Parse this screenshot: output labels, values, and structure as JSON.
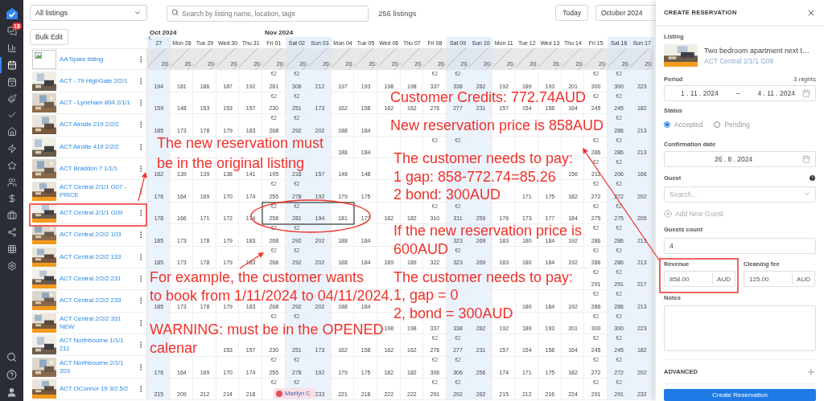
{
  "sidebar": {
    "items": [
      {
        "selected": false,
        "badge": "18"
      },
      {
        "selected": false
      },
      {
        "selected": true
      },
      {
        "selected": false
      },
      {
        "selected": false
      },
      {
        "selected": false
      },
      {
        "selected": false
      },
      {
        "selected": false
      },
      {
        "selected": false
      },
      {
        "selected": false
      },
      {
        "selected": false
      },
      {
        "selected": false
      },
      {
        "selected": false
      },
      {
        "selected": false
      },
      {
        "selected": false
      }
    ],
    "bottom_items": [
      {
        "selected": false
      },
      {
        "selected": false
      },
      {
        "selected": false
      }
    ]
  },
  "toolbar": {
    "filter": "All listings",
    "search_placeholder": "Search by listing name, location, tags",
    "count": "256 listings",
    "today": "Today",
    "month": "October 2024",
    "bulk_edit": "Bulk Edit"
  },
  "days": [
    {
      "label": "27",
      "weekend": true,
      "month": "Oct 2024"
    },
    {
      "label": "Mon 28",
      "weekend": false
    },
    {
      "label": "Tue 29",
      "weekend": false
    },
    {
      "label": "Wed 30",
      "weekend": false
    },
    {
      "label": "Thu 31",
      "weekend": false
    },
    {
      "label": "Fri 01",
      "weekend": false,
      "month": "Nov 2024"
    },
    {
      "label": "Sat 02",
      "weekend": true
    },
    {
      "label": "Sun 03",
      "weekend": true
    },
    {
      "label": "Mon 04",
      "weekend": false
    },
    {
      "label": "Tue 05",
      "weekend": false
    },
    {
      "label": "Wed 06",
      "weekend": false
    },
    {
      "label": "Thu 07",
      "weekend": false
    },
    {
      "label": "Fri 08",
      "weekend": false
    },
    {
      "label": "Sat 09",
      "weekend": true
    },
    {
      "label": "Sun 10",
      "weekend": true
    },
    {
      "label": "Mon 11",
      "weekend": false
    },
    {
      "label": "Tue 12",
      "weekend": false
    },
    {
      "label": "Wed 13",
      "weekend": false
    },
    {
      "label": "Thu 14",
      "weekend": false
    },
    {
      "label": "Fri 15",
      "weekend": false
    },
    {
      "label": "Sat 16",
      "weekend": true
    },
    {
      "label": "Sun 17",
      "weekend": true
    }
  ],
  "rows": [
    {
      "name": "AA Spare listing",
      "image_missing": true,
      "tagged": false,
      "kind": "blocked",
      "cells": [
        {
          "price": "20"
        },
        {
          "price": "20"
        },
        {
          "price": "20"
        },
        {
          "price": "20"
        },
        {
          "price": "20"
        },
        {
          "price": "20"
        },
        {
          "price": "20"
        },
        {
          "price": "20"
        },
        {
          "price": "20"
        },
        {
          "price": "20"
        },
        {
          "price": "20"
        },
        {
          "price": "20"
        },
        {
          "price": "20"
        },
        {
          "price": "20"
        },
        {
          "price": "20"
        },
        {
          "price": "20"
        },
        {
          "price": "20"
        },
        {
          "price": "20"
        },
        {
          "price": "20"
        },
        {
          "price": "20"
        },
        {
          "price": "20"
        },
        {
          "price": "20"
        }
      ]
    },
    {
      "name": "ACT - 79 HighGate 2/2/1",
      "image_missing": false,
      "tagged": false,
      "kind": "priced",
      "cells": [
        {
          "price": "194"
        },
        {
          "price": "181"
        },
        {
          "price": "186"
        },
        {
          "price": "187"
        },
        {
          "price": "192"
        },
        {
          "badge": "€2",
          "price": "281"
        },
        {
          "badge": "€2",
          "price": "306"
        },
        {
          "price": "212"
        },
        {
          "price": "197"
        },
        {
          "price": "193"
        },
        {
          "price": "198"
        },
        {
          "price": "198"
        },
        {
          "badge": "€2",
          "price": "337"
        },
        {
          "badge": "€2",
          "price": "338"
        },
        {
          "price": "282"
        },
        {
          "price": "192"
        },
        {
          "price": "189"
        },
        {
          "price": "193"
        },
        {
          "price": "201"
        },
        {
          "badge": "€2",
          "price": "300"
        },
        {
          "badge": "€2",
          "price": "300"
        },
        {
          "price": "223"
        }
      ]
    },
    {
      "name": "ACT - Lyneham 804 2/1/1",
      "image_missing": false,
      "tagged": false,
      "kind": "priced",
      "cells": [
        {
          "price": "159"
        },
        {
          "price": "148"
        },
        {
          "price": "153"
        },
        {
          "price": "153"
        },
        {
          "price": "157"
        },
        {
          "badge": "€2",
          "price": "230"
        },
        {
          "badge": "€2",
          "price": "251"
        },
        {
          "price": "173"
        },
        {
          "price": "162"
        },
        {
          "price": "158"
        },
        {
          "price": "162"
        },
        {
          "price": "162"
        },
        {
          "price": "276"
        },
        {
          "price": "277"
        },
        {
          "price": "231"
        },
        {
          "price": "157"
        },
        {
          "price": "154"
        },
        {
          "price": "158"
        },
        {
          "price": "164"
        },
        {
          "badge": "€2",
          "price": "245"
        },
        {
          "badge": "€2",
          "price": "245"
        },
        {
          "price": "182"
        }
      ]
    },
    {
      "name": "ACT Ainslie 219 2/2/2",
      "image_missing": false,
      "tagged": false,
      "kind": "priced",
      "cells": [
        {
          "price": "185"
        },
        {
          "price": "173"
        },
        {
          "price": "178"
        },
        {
          "price": "179"
        },
        {
          "price": "183"
        },
        {
          "badge": "€2",
          "price": "268"
        },
        {
          "badge": "€2",
          "price": "292"
        },
        {
          "price": "202"
        },
        {
          "price": "188"
        },
        {
          "price": "184"
        },
        {},
        {},
        {},
        {},
        {},
        {},
        {},
        {},
        {},
        {},
        {
          "badge": "€2",
          "price": "286"
        },
        {
          "price": "213"
        }
      ]
    },
    {
      "name": "ACT Ainslie 419 2/2/2",
      "image_missing": false,
      "tagged": false,
      "kind": "priced",
      "cells": [
        {},
        {},
        {},
        {},
        {},
        {},
        {},
        {},
        {
          "price": "188"
        },
        {
          "price": "184"
        },
        {},
        {},
        {
          "badge": "€2"
        },
        {
          "badge": "€2"
        },
        {},
        {},
        {},
        {},
        {},
        {
          "badge": "€2",
          "price": "286"
        },
        {
          "badge": "€2",
          "price": "286"
        },
        {
          "price": "213"
        }
      ]
    },
    {
      "name": "ACT Braddon 7 1/1/1",
      "image_missing": false,
      "tagged": false,
      "kind": "priced",
      "cells": [
        {
          "price": "162"
        },
        {
          "price": "139"
        },
        {
          "price": "139"
        },
        {
          "price": "138"
        },
        {
          "price": "141"
        },
        {
          "price": "195"
        },
        {
          "price": "218"
        },
        {
          "price": "157"
        },
        {
          "price": "148"
        },
        {
          "price": "148"
        },
        {},
        {},
        {},
        {},
        {},
        {},
        {},
        {},
        {
          "price": "156"
        },
        {
          "badge": "€2",
          "price": "211"
        },
        {
          "badge": "€2",
          "price": "206"
        },
        {
          "price": "166"
        }
      ]
    },
    {
      "name": "ACT Central 2/1/1 G07 - PRICE",
      "image_missing": false,
      "tagged": true,
      "kind": "priced",
      "cells": [
        {
          "price": "176"
        },
        {
          "price": "164"
        },
        {
          "price": "169"
        },
        {
          "price": "170"
        },
        {
          "price": "174"
        },
        {
          "badge": "€2",
          "price": "255"
        },
        {
          "badge": "€2",
          "price": "278"
        },
        {
          "price": "192"
        },
        {
          "price": "179"
        },
        {
          "price": "175"
        },
        {},
        {},
        {},
        {},
        {},
        {},
        {
          "price": "171"
        },
        {
          "price": "175"
        },
        {
          "price": "182"
        },
        {
          "badge": "€2",
          "price": "272"
        },
        {
          "badge": "€2",
          "price": "272"
        },
        {
          "price": "202"
        }
      ]
    },
    {
      "name": "ACT Central 2/1/1 G09",
      "image_missing": false,
      "tagged": true,
      "kind": "priced",
      "cells": [
        {
          "price": "178"
        },
        {
          "price": "166"
        },
        {
          "price": "171"
        },
        {
          "price": "172"
        },
        {
          "price": "174"
        },
        {
          "badge": "€2",
          "price": "258"
        },
        {
          "badge": "€2",
          "price": "281"
        },
        {
          "price": "194"
        },
        {
          "price": "181"
        },
        {
          "price": "177"
        },
        {
          "price": "182"
        },
        {
          "price": "182"
        },
        {
          "badge": "€2",
          "price": "310"
        },
        {
          "badge": "€2",
          "price": "311"
        },
        {
          "price": "259"
        },
        {
          "price": "176"
        },
        {
          "price": "173"
        },
        {
          "price": "177"
        },
        {
          "price": "184"
        },
        {
          "badge": "€2",
          "price": "275"
        },
        {
          "badge": "€2",
          "price": "275"
        },
        {
          "price": "205"
        }
      ]
    },
    {
      "name": "ACT Central 2/2/2 103",
      "image_missing": false,
      "tagged": true,
      "kind": "priced",
      "cells": [
        {
          "price": "185"
        },
        {
          "price": "173"
        },
        {
          "price": "178"
        },
        {
          "price": "179"
        },
        {
          "price": "183"
        },
        {
          "badge": "€2",
          "price": "268"
        },
        {
          "badge": "€2",
          "price": "292"
        },
        {
          "price": "202"
        },
        {
          "price": "188"
        },
        {
          "price": "184"
        },
        {},
        {},
        {},
        {
          "price": "323"
        },
        {
          "price": "269"
        },
        {
          "price": "183"
        },
        {
          "price": "180"
        },
        {
          "price": "184"
        },
        {
          "price": "192"
        },
        {
          "badge": "€2",
          "price": "286"
        },
        {
          "badge": "€2",
          "price": "286"
        },
        {
          "price": "213"
        }
      ]
    },
    {
      "name": "ACT Central 2/2/2 133",
      "image_missing": false,
      "tagged": true,
      "kind": "priced",
      "cells": [
        {
          "price": "185"
        },
        {
          "price": "173"
        },
        {
          "price": "178"
        },
        {
          "price": "179"
        },
        {
          "price": "183"
        },
        {
          "badge": "€2",
          "price": "268"
        },
        {
          "badge": "€2",
          "price": "292"
        },
        {
          "price": "202"
        },
        {
          "price": "188"
        },
        {
          "price": "184"
        },
        {
          "price": "189"
        },
        {
          "price": "189"
        },
        {
          "price": "322"
        },
        {
          "badge": "€2",
          "price": "323"
        },
        {
          "price": "269"
        },
        {
          "price": "183"
        },
        {
          "price": "180"
        },
        {
          "price": "184"
        },
        {
          "price": "192"
        },
        {
          "badge": "€2",
          "price": "286"
        },
        {
          "badge": "€2",
          "price": "286"
        },
        {
          "price": "213"
        }
      ]
    },
    {
      "name": "ACT Central 2/2/2 231",
      "image_missing": false,
      "tagged": true,
      "kind": "priced",
      "cells": [
        {},
        {},
        {},
        {},
        {},
        {},
        {},
        {},
        {},
        {},
        {},
        {},
        {},
        {},
        {},
        {},
        {},
        {},
        {},
        {
          "badge": "€2",
          "price": "291"
        },
        {
          "badge": "€2",
          "price": "291"
        },
        {
          "price": "217"
        }
      ]
    },
    {
      "name": "ACT Central 2/2/2 233",
      "image_missing": false,
      "tagged": true,
      "kind": "priced",
      "cells": [
        {
          "price": "185"
        },
        {
          "price": "173"
        },
        {
          "price": "178"
        },
        {
          "price": "179"
        },
        {
          "price": "183"
        },
        {
          "price": "268"
        },
        {
          "price": "292"
        },
        {
          "price": "202"
        },
        {
          "price": "188"
        },
        {
          "price": "184"
        },
        {},
        {},
        {},
        {},
        {},
        {},
        {
          "price": "180"
        },
        {
          "price": "184"
        },
        {
          "price": "192"
        },
        {
          "badge": "€2",
          "price": "286"
        },
        {
          "badge": "€2",
          "price": "286"
        },
        {
          "price": "213"
        }
      ]
    },
    {
      "name": "ACT Central 2/2/2 331 NEW",
      "image_missing": false,
      "tagged": true,
      "kind": "priced",
      "cells": [
        {},
        {},
        {},
        {},
        {},
        {
          "badge": "€2"
        },
        {
          "badge": "€2"
        },
        {},
        {},
        {},
        {
          "price": "198"
        },
        {
          "price": "198"
        },
        {
          "price": "337"
        },
        {
          "price": "338"
        },
        {
          "price": "282"
        },
        {
          "price": "192"
        },
        {
          "price": "189"
        },
        {
          "price": "193"
        },
        {
          "price": "201"
        },
        {
          "badge": "€2",
          "price": "300"
        },
        {
          "badge": "€2",
          "price": "300"
        },
        {
          "price": "223"
        }
      ]
    },
    {
      "name": "ACT Northbourne 1/1/1 211",
      "image_missing": false,
      "tagged": false,
      "kind": "priced",
      "cells": [
        {},
        {},
        {},
        {
          "price": "153"
        },
        {
          "price": "157"
        },
        {
          "price": "230"
        },
        {
          "price": "251"
        },
        {
          "price": "173"
        },
        {
          "price": "162"
        },
        {
          "price": "158"
        },
        {
          "price": "162"
        },
        {
          "price": "162"
        },
        {
          "badge": "€2",
          "price": "276"
        },
        {
          "badge": "€2",
          "price": "277"
        },
        {
          "price": "231"
        },
        {
          "price": "157"
        },
        {
          "price": "154"
        },
        {
          "price": "158"
        },
        {
          "price": "164"
        },
        {
          "badge": "€2",
          "price": "245"
        },
        {
          "badge": "€2",
          "price": "245"
        },
        {
          "price": "182"
        }
      ]
    },
    {
      "name": "ACT Northbourne 2/1/1 203",
      "image_missing": false,
      "tagged": false,
      "kind": "priced",
      "cells": [
        {
          "price": "176"
        },
        {
          "price": "164"
        },
        {
          "price": "169"
        },
        {
          "price": "170"
        },
        {
          "price": "174"
        },
        {
          "badge": "€2",
          "price": "255"
        },
        {
          "badge": "€2",
          "price": "278"
        },
        {
          "price": "192"
        },
        {
          "price": "179"
        },
        {
          "price": "175"
        },
        {
          "price": "182"
        },
        {
          "price": "182"
        },
        {
          "badge": "€2",
          "price": "306"
        },
        {
          "badge": "€2",
          "price": "306"
        },
        {
          "price": "256"
        },
        {
          "price": "174"
        },
        {
          "price": "171"
        },
        {
          "price": "175"
        },
        {
          "price": "182"
        },
        {
          "badge": "€2",
          "price": "272"
        },
        {
          "badge": "€2",
          "price": "272"
        },
        {
          "price": "202"
        }
      ]
    },
    {
      "name": "ACT OConnor 19 3/2.5/2",
      "image_missing": false,
      "tagged": true,
      "kind": "priced",
      "cells": [
        {
          "price": "215"
        },
        {
          "price": "209"
        },
        {
          "price": "212"
        },
        {
          "price": "214"
        },
        {
          "price": "218"
        },
        {
          "badge": "€2",
          "booking": "Marilyn C"
        },
        {
          "badge": "€2"
        },
        {
          "price": "233"
        },
        {
          "price": "221"
        },
        {
          "price": "218"
        },
        {
          "price": "222"
        },
        {
          "price": "222"
        },
        {
          "badge": "€2",
          "price": "291"
        },
        {
          "badge": "€2",
          "price": "292"
        },
        {
          "price": "262"
        },
        {
          "price": "215"
        },
        {
          "price": "212"
        },
        {
          "price": "216"
        },
        {
          "price": "224"
        },
        {
          "badge": "€2",
          "price": "291"
        },
        {
          "badge": "€2",
          "price": "291"
        },
        {
          "price": "232"
        }
      ]
    }
  ],
  "annotations": [
    {
      "lines": [
        "Customer Credits: 772.74AUD"
      ]
    },
    {
      "lines": [
        "New reservation price is 858AUD"
      ]
    },
    {
      "lines": [
        "The new reservation must",
        "be in the original listing"
      ]
    },
    {
      "lines": [
        "The customer needs to pay:",
        "1 gap: 858-772.74=85.26",
        "2 bond: 300AUD"
      ]
    },
    {
      "lines": [
        "If the new reservation price is",
        "600AUD"
      ]
    },
    {
      "lines": [
        "For example, the customer wants",
        "to book from 1/11/2024 to 04/11/2024."
      ]
    },
    {
      "lines": [
        "The customer needs to pay:",
        "1, gap = 0",
        "2, bond = 300AUD"
      ]
    },
    {
      "lines": [
        "WARNING: must be in the OPENED",
        "calenar"
      ]
    }
  ],
  "panel": {
    "title": "CREATE RESERVATION",
    "listing_label": "Listing",
    "listing_title": "Two bedroom apartment next t…",
    "listing_name": "ACT Central 2/1/1 G09",
    "listing_tagged": true,
    "period_label": "Period",
    "nights": "3 nights",
    "period_from": "1 . 11 . 2024",
    "period_dash": "–",
    "period_to": "4 . 11 . 2024",
    "status_label": "Status",
    "statuses": [
      {
        "label": "Accepted",
        "selected": true
      },
      {
        "label": "Pending",
        "selected": false
      }
    ],
    "confirmation_label": "Confirmation date",
    "confirmation_date": "26 . 8 . 2024",
    "guest_label": "Guest",
    "guest_placeholder": "Search...",
    "add_guest": "Add New Guest",
    "guests_count_label": "Guests count",
    "guests_count": "4",
    "revenue_label": "Revenue",
    "revenue": "858.00",
    "revenue_currency": "AUD",
    "cleaning_label": "Cleaning fee",
    "cleaning_fee": "125.00",
    "cleaning_currency": "AUD",
    "notes_label": "Notes",
    "advanced": "ADVANCED",
    "submit": "Create Reservation"
  }
}
